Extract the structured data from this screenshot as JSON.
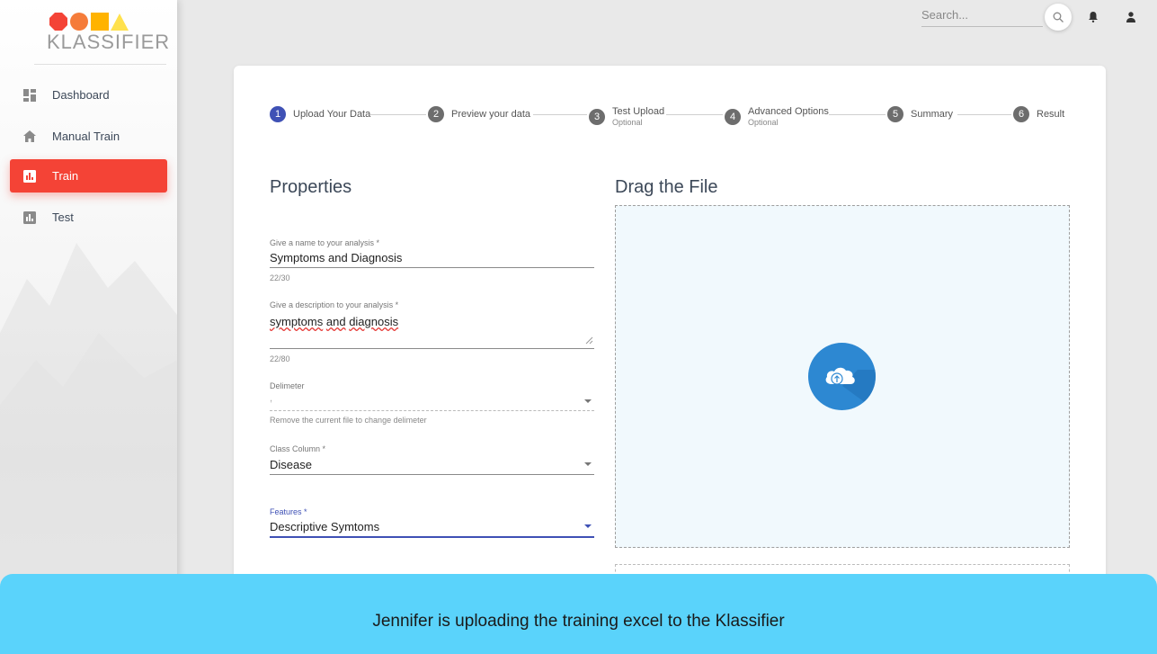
{
  "app": {
    "logo_text": "KLASSIFIER"
  },
  "sidebar": {
    "items": [
      {
        "label": "Dashboard",
        "icon": "dashboard-icon",
        "active": false
      },
      {
        "label": "Manual Train",
        "icon": "home-icon",
        "active": false
      },
      {
        "label": "Train",
        "icon": "bar-chart-icon",
        "active": true
      },
      {
        "label": "Test",
        "icon": "bar-chart-icon",
        "active": false
      }
    ]
  },
  "topbar": {
    "search_placeholder": "Search...",
    "icons": [
      "search-icon",
      "bell-icon",
      "person-icon"
    ]
  },
  "stepper": {
    "steps": [
      {
        "num": "1",
        "label": "Upload Your Data",
        "optional": "",
        "active": true
      },
      {
        "num": "2",
        "label": "Preview your data",
        "optional": ""
      },
      {
        "num": "3",
        "label": "Test Upload",
        "optional": "Optional"
      },
      {
        "num": "4",
        "label": "Advanced Options",
        "optional": "Optional"
      },
      {
        "num": "5",
        "label": "Summary",
        "optional": ""
      },
      {
        "num": "6",
        "label": "Result",
        "optional": ""
      }
    ]
  },
  "properties": {
    "title": "Properties",
    "name_label": "Give a name to your analysis *",
    "name_value": "Symptoms and Diagnosis",
    "name_count": "22/30",
    "desc_label": "Give a description to your analysis *",
    "desc_value_1": "symptoms",
    "desc_value_2": "and",
    "desc_value_3": "diagnosis",
    "desc_count": "22/80",
    "delim_label": "Delimeter",
    "delim_value": ",",
    "delim_hint": "Remove the current file to change delimeter",
    "class_label": "Class Column *",
    "class_value": "Disease",
    "features_label": "Features *",
    "features_value": "Descriptive Symtoms"
  },
  "dropzone": {
    "title": "Drag the File",
    "icon": "cloud-upload-icon"
  },
  "colors": {
    "accent": "#f44336",
    "primary": "#3f51b5",
    "cloud": "#2d88d2",
    "caption_bg": "#5ad3fb"
  },
  "caption": "Jennifer is uploading the training excel to the Klassifier"
}
